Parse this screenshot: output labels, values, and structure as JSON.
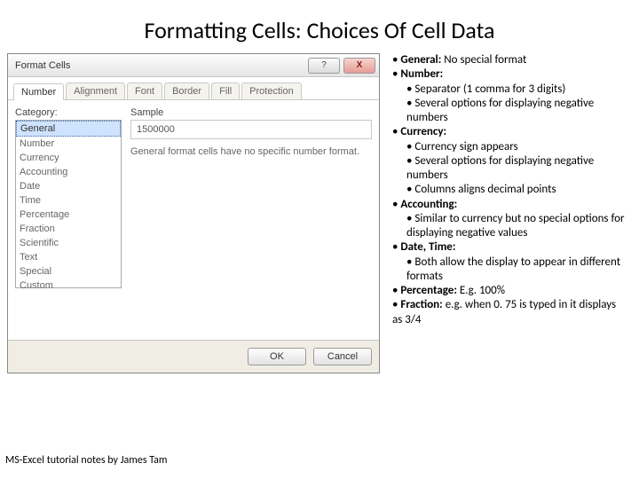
{
  "title": "Formatting Cells: Choices Of Cell Data",
  "dialog": {
    "window_title": "Format Cells",
    "help_label": "?",
    "close_label": "X",
    "tabs": [
      "Number",
      "Alignment",
      "Font",
      "Border",
      "Fill",
      "Protection"
    ],
    "category_label": "Category:",
    "categories": [
      "General",
      "Number",
      "Currency",
      "Accounting",
      "Date",
      "Time",
      "Percentage",
      "Fraction",
      "Scientific",
      "Text",
      "Special",
      "Custom"
    ],
    "sample_label": "Sample",
    "sample_value": "1500000",
    "description": "General format cells have no specific number format.",
    "ok_label": "OK",
    "cancel_label": "Cancel"
  },
  "notes": {
    "general_head": "General:",
    "general_text": " No special format",
    "number_head": "Number:",
    "number_sub1": "Separator (1 comma for 3 digits)",
    "number_sub2": "Several options for displaying negative numbers",
    "currency_head": "Currency:",
    "currency_sub1": "Currency sign appears",
    "currency_sub2": "Several options for displaying negative numbers",
    "currency_sub3": "Columns aligns decimal points",
    "accounting_head": "Accounting:",
    "accounting_sub1": "Similar to currency but no special options for displaying negative values",
    "datetime_head": "Date, Time:",
    "datetime_sub1": "Both allow the display to appear in different formats",
    "percentage_head": "Percentage:",
    "percentage_text": " E.g. 100%",
    "fraction_head": "Fraction:",
    "fraction_text": " e.g. when 0. 75 is typed in it displays as 3/4"
  },
  "footer": "MS-Excel tutorial notes by James Tam"
}
